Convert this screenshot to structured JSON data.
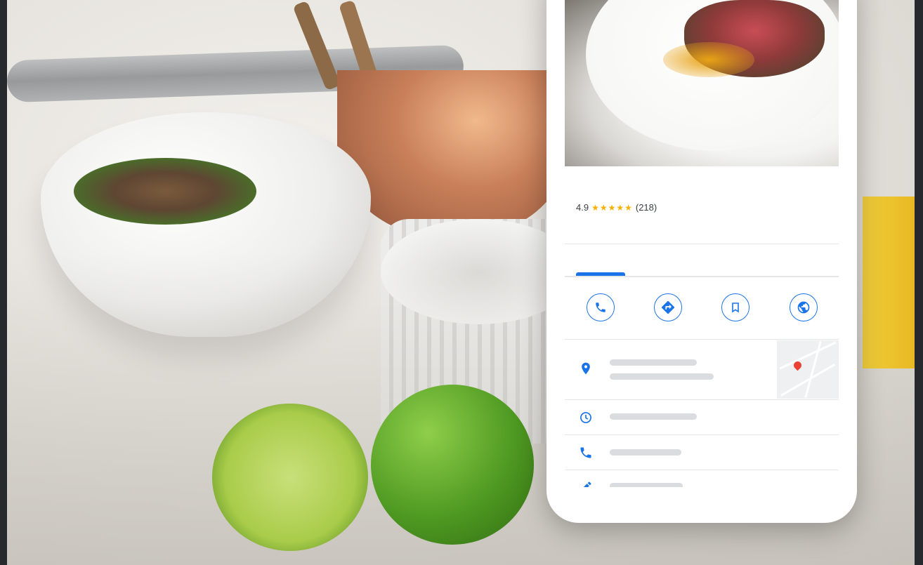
{
  "listing": {
    "rating_value": "4.9",
    "stars": "★★★★★",
    "review_count": "(218)"
  },
  "actions": [
    {
      "name": "call-icon"
    },
    {
      "name": "directions-icon"
    },
    {
      "name": "save-icon"
    },
    {
      "name": "website-icon"
    }
  ],
  "info_rows": [
    {
      "icon": "location-pin-icon"
    },
    {
      "icon": "clock-icon"
    },
    {
      "icon": "phone-icon"
    },
    {
      "icon": "edit-pencil-icon"
    }
  ],
  "colors": {
    "accent": "#1a73e8",
    "star": "#f9b000",
    "placeholder": "#dadce0"
  }
}
